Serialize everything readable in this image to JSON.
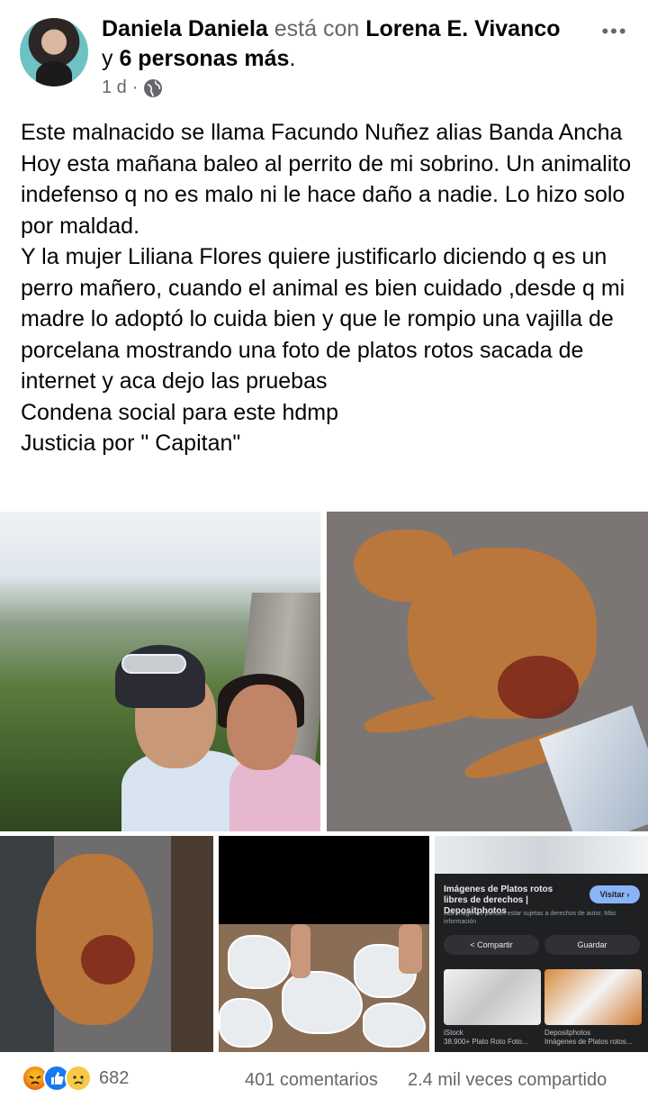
{
  "post": {
    "author": "Daniela Daniela",
    "with_text": "está con",
    "tagged": "Lorena E. Vivanco",
    "and_text": "y",
    "others": "6 personas más",
    "period": ".",
    "time": "1 d",
    "dot": "·",
    "body": [
      "Este malnacido se llama Facundo Nuñez alias Banda Ancha Hoy esta mañana baleo al perrito de mi sobrino. Un animalito indefenso q no es malo ni le hace daño a nadie. Lo hizo solo por maldad.",
      "Y la mujer Liliana Flores quiere justificarlo diciendo q es un perro mañero, cuando el animal es bien cuidado ,desde q mi madre lo adoptó lo cuida bien y que le rompio una vajilla de porcelana mostrando una foto de platos rotos sacada de internet y aca dejo las pruebas",
      "Condena social para este hdmp",
      "Justicia por \" Capitan\""
    ]
  },
  "search_card": {
    "title": "Imágenes de Platos rotos libres de derechos | Depositphotos",
    "visit": "Visitar ›",
    "note": "Las imágenes pueden estar sujetas a derechos de autor. Más información",
    "share": "< Compartir",
    "save": "Guardar",
    "source1": "iStock",
    "caption1": "38.900+ Plato Roto Foto...",
    "source2": "Depositphotos",
    "caption2": "Imágenes de Platos rotos..."
  },
  "footer": {
    "reaction_count": "682",
    "comments": "401 comentarios",
    "shares": "2.4 mil veces compartido"
  },
  "icons": [
    "more-icon",
    "globe-icon",
    "angry-reaction-icon",
    "like-reaction-icon",
    "sad-reaction-icon"
  ],
  "colors": {
    "secondary_text": "#65676b",
    "like_blue": "#1877f2"
  }
}
